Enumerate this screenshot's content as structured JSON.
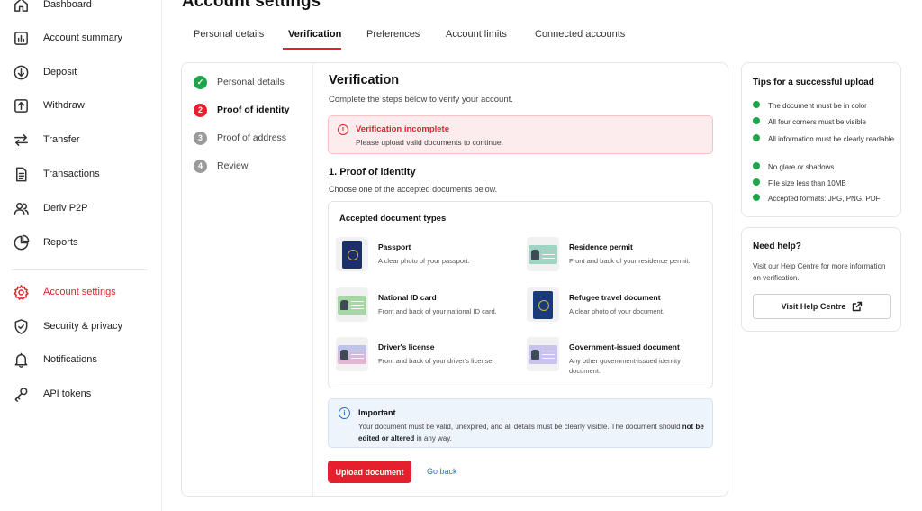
{
  "page_title": "Account settings",
  "sidebar": {
    "items": [
      {
        "label": "Dashboard",
        "icon": "home-icon",
        "active": false
      },
      {
        "label": "Account summary",
        "icon": "chart-icon",
        "active": false
      },
      {
        "label": "Deposit",
        "icon": "deposit-icon",
        "active": false
      },
      {
        "label": "Withdraw",
        "icon": "withdraw-icon",
        "active": false
      },
      {
        "label": "Transfer",
        "icon": "transfer-icon",
        "active": false
      },
      {
        "label": "Transactions",
        "icon": "document-icon",
        "active": false
      },
      {
        "label": "Deriv P2P",
        "icon": "users-icon",
        "active": false
      },
      {
        "label": "Reports",
        "icon": "pie-chart-icon",
        "active": false
      },
      {
        "label": "Account settings",
        "icon": "gear-icon",
        "active": true
      },
      {
        "label": "Security & privacy",
        "icon": "shield-icon",
        "active": false
      },
      {
        "label": "Notifications",
        "icon": "bell-icon",
        "active": false
      },
      {
        "label": "API tokens",
        "icon": "key-icon",
        "active": false
      }
    ]
  },
  "tabs": [
    {
      "label": "Personal details",
      "active": false
    },
    {
      "label": "Verification",
      "active": true
    },
    {
      "label": "Preferences",
      "active": false
    },
    {
      "label": "Account limits",
      "active": false
    },
    {
      "label": "Connected accounts",
      "active": false
    }
  ],
  "steps": [
    {
      "number": "✓",
      "label": "Personal details",
      "state": "done"
    },
    {
      "number": "2",
      "label": "Proof of identity",
      "state": "current"
    },
    {
      "number": "3",
      "label": "Proof of address",
      "state": "pending"
    },
    {
      "number": "4",
      "label": "Review",
      "state": "pending"
    }
  ],
  "verification": {
    "title": "Verification",
    "subtitle": "Complete the steps below to verify your account.",
    "alert_icon": "!",
    "alert_title": "Verification incomplete",
    "alert_message": "Please upload valid documents to continue.",
    "section_title": "1.  Proof of identity",
    "section_subtitle": "Choose one of the accepted documents below.",
    "documents_title": "Accepted document types",
    "documents": [
      {
        "name": "Passport",
        "description": "A clear photo of your passport.",
        "icon": "passport-icon"
      },
      {
        "name": "Residence permit",
        "description": "Front and back of your residence permit.",
        "icon": "residence-permit-icon"
      },
      {
        "name": "National ID card",
        "description": "Front and back of your national ID card.",
        "icon": "id-card-icon"
      },
      {
        "name": "Refugee travel document",
        "description": "A clear photo of your document.",
        "icon": "travel-document-icon"
      },
      {
        "name": "Driver's license",
        "description": "Front and back of your driver's license.",
        "icon": "drivers-license-icon"
      },
      {
        "name": "Government-issued document",
        "description": "Any other government-issued identity document.",
        "icon": "government-document-icon"
      }
    ],
    "important_icon": "i",
    "important_title": "Important",
    "important_message_1": "Your document must be valid, unexpired, and all details must be clearly visible. The document should ",
    "important_message_bold": "not be edited or altered",
    "important_message_2": " in any way.",
    "upload_button": "Upload document",
    "go_back": "Go back"
  },
  "tips": {
    "title": "Tips for a successful upload",
    "items": [
      "The document must be in color",
      "All four corners must be visible",
      "All information must be clearly readable",
      "No glare or shadows",
      "File size less than 10MB",
      "Accepted formats: JPG, PNG, PDF"
    ]
  },
  "help": {
    "title": "Need help?",
    "message": "Visit our Help Centre for more information on verification.",
    "button": "Visit Help Centre"
  },
  "colors": {
    "accent": "#e5202e",
    "success": "#1ea44b",
    "info": "#2f6fc7"
  }
}
